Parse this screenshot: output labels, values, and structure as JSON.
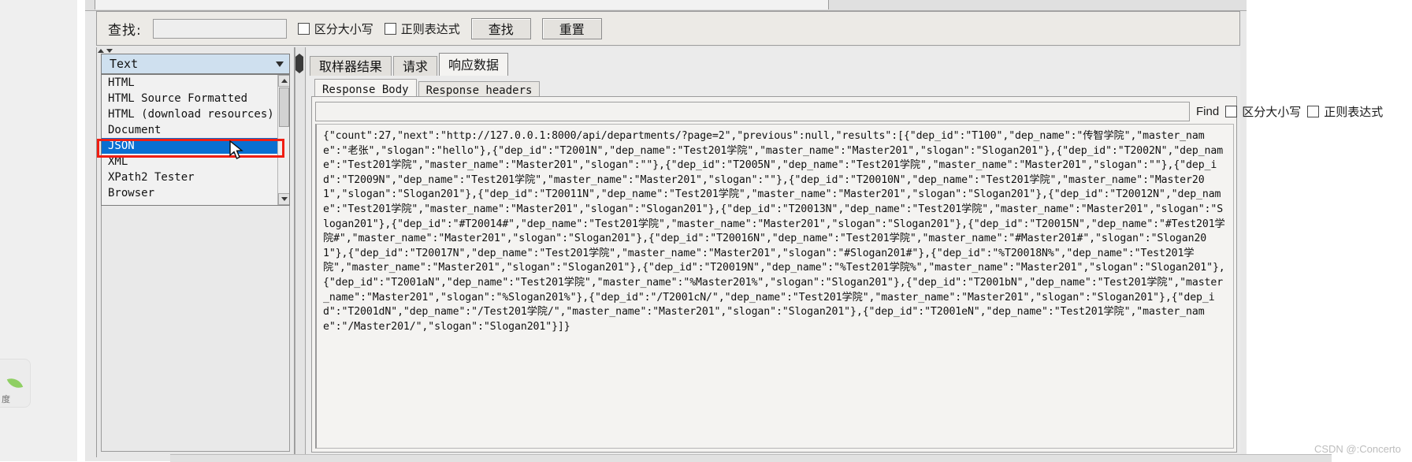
{
  "toolbar": {
    "search_label": "查找:",
    "search_value": "",
    "search_placeholder": "",
    "case_sensitive_label": "区分大小写",
    "regex_label": "正则表达式",
    "find_button": "查找",
    "reset_button": "重置"
  },
  "renderer": {
    "selected": "Text",
    "chevron_icon": "chevron-down-icon",
    "options": [
      "HTML",
      "HTML Source Formatted",
      "HTML (download resources)",
      "Document",
      "JSON",
      "XML",
      "XPath2 Tester",
      "Browser"
    ],
    "highlighted_option": "JSON",
    "highlight_box_color": "#f01e13",
    "selection_color": "#0a6fd1"
  },
  "result_tabs": {
    "items": [
      "取样器结果",
      "请求",
      "响应数据"
    ],
    "active": "响应数据"
  },
  "response_tabs": {
    "items": [
      "Response Body",
      "Response headers"
    ],
    "active": "Response Body"
  },
  "response_find": {
    "value": "",
    "find_label": "Find",
    "case_sensitive_label": "区分大小写",
    "regex_label": "正则表达式"
  },
  "response_body": {
    "text": "{\"count\":27,\"next\":\"http://127.0.0.1:8000/api/departments/?page=2\",\"previous\":null,\"results\":[{\"dep_id\":\"T100\",\"dep_name\":\"传智学院\",\"master_name\":\"老张\",\"slogan\":\"hello\"},{\"dep_id\":\"T2001N\",\"dep_name\":\"Test201学院\",\"master_name\":\"Master201\",\"slogan\":\"Slogan201\"},{\"dep_id\":\"T2002N\",\"dep_name\":\"Test201学院\",\"master_name\":\"Master201\",\"slogan\":\"\"},{\"dep_id\":\"T2005N\",\"dep_name\":\"Test201学院\",\"master_name\":\"Master201\",\"slogan\":\"\"},{\"dep_id\":\"T2009N\",\"dep_name\":\"Test201学院\",\"master_name\":\"Master201\",\"slogan\":\"\"},{\"dep_id\":\"T20010N\",\"dep_name\":\"Test201学院\",\"master_name\":\"Master201\",\"slogan\":\"Slogan201\"},{\"dep_id\":\"T20011N\",\"dep_name\":\"Test201学院\",\"master_name\":\"Master201\",\"slogan\":\"Slogan201\"},{\"dep_id\":\"T20012N\",\"dep_name\":\"Test201学院\",\"master_name\":\"Master201\",\"slogan\":\"Slogan201\"},{\"dep_id\":\"T20013N\",\"dep_name\":\"Test201学院\",\"master_name\":\"Master201\",\"slogan\":\"Slogan201\"},{\"dep_id\":\"#T20014#\",\"dep_name\":\"Test201学院\",\"master_name\":\"Master201\",\"slogan\":\"Slogan201\"},{\"dep_id\":\"T20015N\",\"dep_name\":\"#Test201学院#\",\"master_name\":\"Master201\",\"slogan\":\"Slogan201\"},{\"dep_id\":\"T20016N\",\"dep_name\":\"Test201学院\",\"master_name\":\"#Master201#\",\"slogan\":\"Slogan201\"},{\"dep_id\":\"T20017N\",\"dep_name\":\"Test201学院\",\"master_name\":\"Master201\",\"slogan\":\"#Slogan201#\"},{\"dep_id\":\"%T20018N%\",\"dep_name\":\"Test201学院\",\"master_name\":\"Master201\",\"slogan\":\"Slogan201\"},{\"dep_id\":\"T20019N\",\"dep_name\":\"%Test201学院%\",\"master_name\":\"Master201\",\"slogan\":\"Slogan201\"},{\"dep_id\":\"T2001aN\",\"dep_name\":\"Test201学院\",\"master_name\":\"%Master201%\",\"slogan\":\"Slogan201\"},{\"dep_id\":\"T2001bN\",\"dep_name\":\"Test201学院\",\"master_name\":\"Master201\",\"slogan\":\"%Slogan201%\"},{\"dep_id\":\"/T2001cN/\",\"dep_name\":\"Test201学院\",\"master_name\":\"Master201\",\"slogan\":\"Slogan201\"},{\"dep_id\":\"T2001dN\",\"dep_name\":\"/Test201学院/\",\"master_name\":\"Master201\",\"slogan\":\"Slogan201\"},{\"dep_id\":\"T2001eN\",\"dep_name\":\"Test201学院\",\"master_name\":\"/Master201/\",\"slogan\":\"Slogan201\"}]}"
  },
  "watermark": {
    "text": "CSDN @:Concerto"
  },
  "side_gutter": {
    "icon": "leaf-icon",
    "label": "度"
  }
}
